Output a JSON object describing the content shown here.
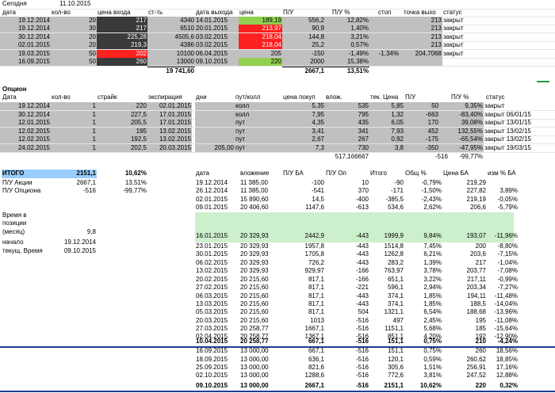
{
  "today": {
    "label": "Сегодня",
    "date": "11.10.2015"
  },
  "stocks": {
    "header": [
      "дата",
      "кол-во",
      "цена входа",
      "ст-ть",
      "дата выхода",
      "цена",
      "П/У",
      "П/У %",
      "стоп",
      "точка выхо",
      "статус"
    ],
    "rows": [
      [
        "19.12.2014",
        "20",
        "217",
        "4340",
        "14.01.2015",
        "189,19",
        "556,2",
        "12,82%",
        "",
        "213",
        "закрыт"
      ],
      [
        "19.12.2014",
        "30",
        "217",
        "6510",
        "20.01.2015",
        "213,97",
        "90,9",
        "1,40%",
        "",
        "213",
        "закрыт"
      ],
      [
        "30.12.2014",
        "20",
        "225,28",
        "4505,6",
        "03.02.2015",
        "218,04",
        "144,8",
        "3,21%",
        "",
        "213",
        "закрыт"
      ],
      [
        "02.01.2015",
        "20",
        "219,3",
        "4386",
        "03.02.2015",
        "218,04",
        "25,2",
        "0,57%",
        "",
        "213",
        "закрыт"
      ],
      [
        "19.03.2015",
        "50",
        "202",
        "10100",
        "06.04.2015",
        "205",
        "-150",
        "-1,49%",
        "-1,34%",
        "204,7068",
        "закрыт"
      ],
      [
        "16.09.2015",
        "50",
        "260",
        "13000",
        "09.10.2015",
        "220",
        "2000",
        "15,38%",
        "",
        "",
        ""
      ]
    ],
    "total_cost": "19 741,60",
    "total_pl": "2667,1",
    "total_pct": "13,51%"
  },
  "options": {
    "title": "Опцион",
    "header": [
      "Дата",
      "кол-во",
      "страйк",
      "экспирация",
      "дни",
      "пут/колл",
      "цена покуп",
      "влож.",
      "тек. Цена",
      "П/У",
      "П/У %",
      "статус"
    ],
    "rows": [
      [
        "19.12.2014",
        "1",
        "220",
        "02.01.2015",
        "",
        "колл",
        "5,35",
        "535",
        "5,85",
        "50",
        "9,35%",
        "закрыт"
      ],
      [
        "30.12.2014",
        "1",
        "227,5",
        "17.01.2015",
        "",
        "колл",
        "7,95",
        "795",
        "1,32",
        "-663",
        "-83,40%",
        "закрыт 06/01/15"
      ],
      [
        "12.01.2015",
        "1",
        "205,5",
        "17.01.2015",
        "",
        "пут",
        "4,35",
        "435",
        "6,05",
        "170",
        "39,08%",
        "закрыт 13/01/15"
      ],
      [
        "12.02.2015",
        "1",
        "195",
        "13.02.2015",
        "",
        "пут",
        "3,41",
        "341",
        "7,93",
        "452",
        "132,55%",
        "закрыт 13/02/15"
      ],
      [
        "12.02.2015",
        "1",
        "192,5",
        "13.02.2015",
        "",
        "пут",
        "2,67",
        "267",
        "0,92",
        "-175",
        "-65,54%",
        "закрыт 13/02/15"
      ],
      [
        "24.02.2015",
        "1",
        "202,5",
        "20.03.2015",
        "205,00",
        "пут",
        "7,3",
        "730",
        "3,8",
        "-350",
        "-47,95%",
        "закрыт 19/03/15"
      ]
    ],
    "total_invest": "517,166667",
    "total_pl": "-516",
    "total_pct": "-99,77%"
  },
  "summary": {
    "itogo_label": "ИТОГО",
    "itogo_value": "2151,1",
    "itogo_pct": "10,62%",
    "stock_label": "П/У Акции",
    "stock_value": "2667,1",
    "stock_pct": "13,51%",
    "opt_label": "П/У Опциона",
    "opt_value": "-516",
    "opt_pct": "-99,77%",
    "time_label_1": "Время в",
    "time_label_2": "позиции",
    "time_label_3": "(месяц)",
    "time_value": "9,8",
    "start_label": "начало",
    "start_value": "19.12.2014",
    "now_label": "текущ. Время",
    "now_value": "09.10.2015"
  },
  "history": {
    "header": [
      "дата",
      "вложение",
      "П/У БА",
      "П/У Оп",
      "Итого",
      "Общ %",
      "Цена БА",
      "изм % БА"
    ],
    "rows": [
      [
        "19.12.2014",
        "11 385,00",
        "-100",
        "10",
        "-90",
        "-0,79%",
        "219,29",
        ""
      ],
      [
        "26.12.2014",
        "11 385,00",
        "-541",
        "370",
        "-171",
        "-1,50%",
        "227,82",
        "3,89%"
      ],
      [
        "02.01.2015",
        "15 890,60",
        "14,5",
        "-400",
        "-385,5",
        "-2,43%",
        "219,19",
        "-0,05%"
      ],
      [
        "09.01.2015",
        "20 406,60",
        "1147,6",
        "-613",
        "534,6",
        "2,62%",
        "206,6",
        "-5,79%"
      ],
      [
        "",
        "",
        "",
        "",
        "",
        "",
        "",
        ""
      ],
      [
        "",
        "",
        "",
        "",
        "",
        "",
        "",
        ""
      ],
      [
        "16.01.2015",
        "20 329,93",
        "2442,9",
        "-443",
        "1999,9",
        "9,84%",
        "193,07",
        "-11,96%"
      ],
      [
        "23.01.2015",
        "20 329,93",
        "1957,8",
        "-443",
        "1514,8",
        "7,45%",
        "200",
        "-8,80%"
      ],
      [
        "30.01.2015",
        "20 329,93",
        "1705,8",
        "-443",
        "1262,8",
        "6,21%",
        "203,6",
        "-7,15%"
      ],
      [
        "06.02.2015",
        "20 329,93",
        "726,2",
        "-443",
        "283,2",
        "1,39%",
        "217",
        "-1,04%"
      ],
      [
        "13.02.2015",
        "20 329,93",
        "929,97",
        "-166",
        "763,97",
        "3,78%",
        "203,77",
        "-7,08%"
      ],
      [
        "20.02.2015",
        "20 215,60",
        "817,1",
        "-166",
        "651,1",
        "3,22%",
        "217,11",
        "-0,99%"
      ],
      [
        "27.02.2015",
        "20 215,60",
        "817,1",
        "-221",
        "596,1",
        "2,94%",
        "203,34",
        "-7,27%"
      ],
      [
        "06.03.2015",
        "20 215,60",
        "817,1",
        "-443",
        "374,1",
        "1,85%",
        "194,11",
        "-11,48%"
      ],
      [
        "13.03.2015",
        "20 215,60",
        "817,1",
        "-443",
        "374,1",
        "1,85%",
        "188,5",
        "-14,04%"
      ],
      [
        "05.03.2015",
        "20 215,60",
        "817,1",
        "504",
        "1321,1",
        "6,54%",
        "188,68",
        "-13,96%"
      ],
      [
        "20.03.2015",
        "20 215,60",
        "1013",
        "-516",
        "497",
        "2,45%",
        "195",
        "-11,08%"
      ],
      [
        "27.03.2015",
        "20 258,77",
        "1667,1",
        "-516",
        "1151,1",
        "5,68%",
        "185",
        "-15,64%"
      ],
      [
        "02.04.2015",
        "20 258,77",
        "1367,1",
        "-516",
        "851,1",
        "4,20%",
        "192",
        "-12,90%"
      ],
      [
        "10.04.2015",
        "20 258,77",
        "667,1",
        "-516",
        "151,1",
        "0,75%",
        "210",
        "-4,24%"
      ],
      [
        "16.09.2015",
        "13 000,00",
        "667,1",
        "-516",
        "151,1",
        "0,75%",
        "260",
        "18,56%"
      ],
      [
        "18.09.2015",
        "13 000,00",
        "636,1",
        "-516",
        "120,1",
        "0,59%",
        "260,62",
        "18,85%"
      ],
      [
        "25.09.2015",
        "13 000,00",
        "821,6",
        "-516",
        "305,6",
        "1,51%",
        "256,91",
        "17,16%"
      ],
      [
        "02.10.2015",
        "13 000,00",
        "1288,6",
        "-516",
        "772,6",
        "3,81%",
        "247,52",
        "12,88%"
      ],
      [
        "09.10.2015",
        "13 000,00",
        "2667,1",
        "-516",
        "2151,1",
        "10,62%",
        "220",
        "0,32%"
      ]
    ]
  },
  "colors": {
    "gray": "#c0c0c0",
    "green": "#ccefcc",
    "blue": "#99ccff",
    "dark": "#3a3a3a",
    "red": "#ff2020",
    "lightgreen": "#92d050"
  }
}
